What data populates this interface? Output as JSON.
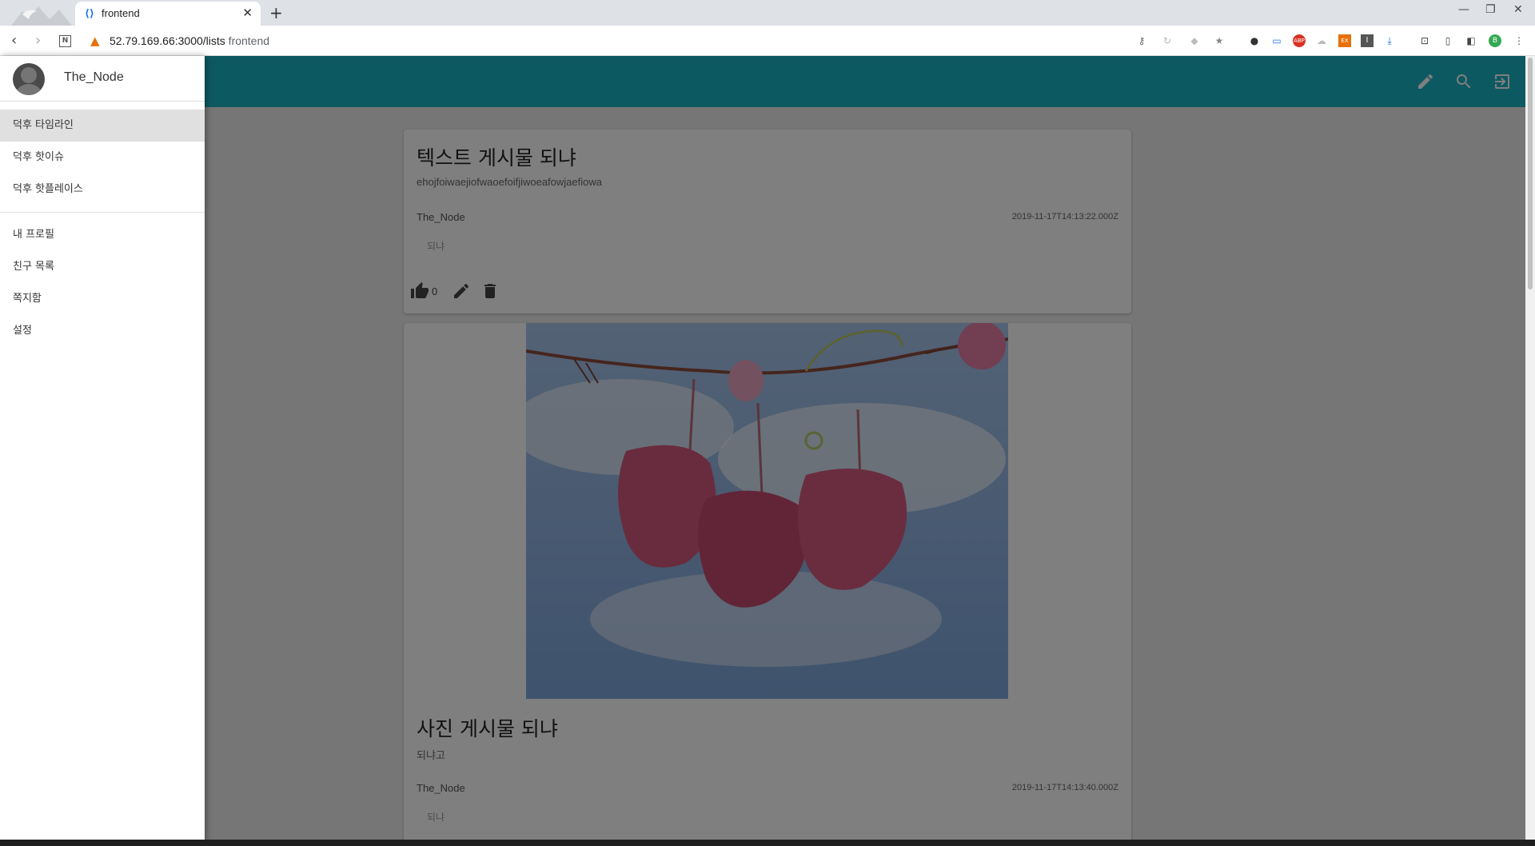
{
  "browser": {
    "tab_title": "frontend",
    "url_host": "52.79.169.66:3000/lists",
    "url_extra": "frontend"
  },
  "drawer": {
    "username": "The_Node",
    "primary_items": [
      {
        "label": "덕후 타임라인",
        "active": true
      },
      {
        "label": "덕후 핫이슈"
      },
      {
        "label": "덕후 핫플레이스"
      }
    ],
    "secondary_items": [
      {
        "label": "내 프로필"
      },
      {
        "label": "친구 목록"
      },
      {
        "label": "쪽지함"
      },
      {
        "label": "설정"
      }
    ]
  },
  "app_bar": {
    "color": "#1ab2c3",
    "icons": [
      "edit-icon",
      "search-icon",
      "logout-icon"
    ]
  },
  "posts": [
    {
      "title": "텍스트 게시물 되냐",
      "body": "ehojfoiwaejiofwaoefoifjiwoeafowjaefiowa",
      "author": "The_Node",
      "date": "2019-11-17T14:13:22.000Z",
      "tag": "되냐",
      "likes": "0"
    },
    {
      "title": "사진 게시물 되냐",
      "body": "되냐고",
      "author": "The_Node",
      "date": "2019-11-17T14:13:40.000Z",
      "tag": "되냐"
    }
  ]
}
